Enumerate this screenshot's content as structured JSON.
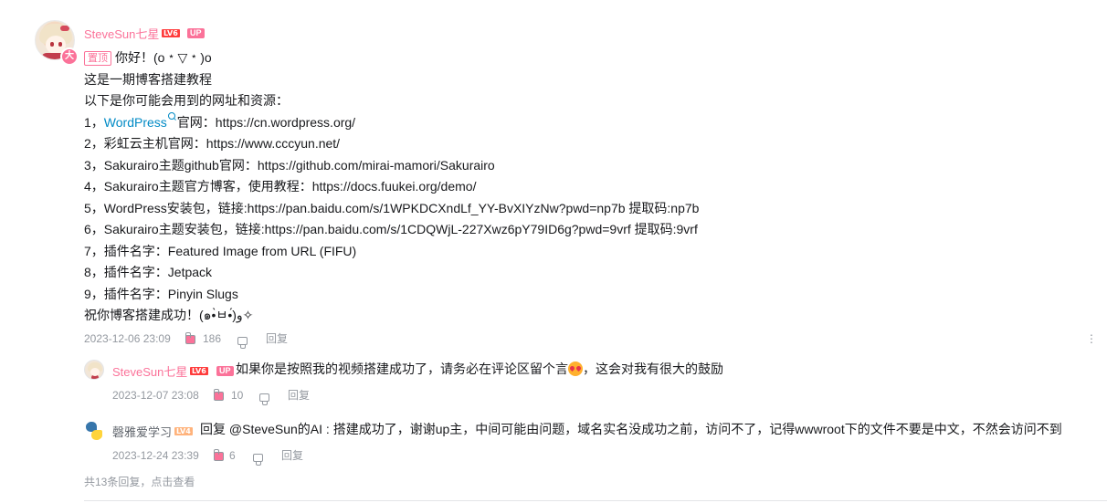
{
  "comment": {
    "username": "SteveSun七星",
    "level_badge": "LV6",
    "up_badge": "UP",
    "vip_badge": "大",
    "pinned_label": "置顶",
    "lines": [
      "你好！(o﹡▽﹡)o",
      "这是一期博客搭建教程",
      "以下是你可能会用到的网址和资源：",
      "1，",
      "2，彩虹云主机官网：https://www.cccyun.net/",
      "3，Sakurairo主题github官网：https://github.com/mirai-mamori/Sakurairo",
      "4，Sakurairo主题官方博客，使用教程：https://docs.fuukei.org/demo/",
      "5，WordPress安装包，链接:https://pan.baidu.com/s/1WPKDCXndLf_YY-BvXIYzNw?pwd=np7b 提取码:np7b",
      "6，Sakurairo主题安装包，链接:https://pan.baidu.com/s/1CDQWjL-227Xwz6pY79ID6g?pwd=9vrf 提取码:9vrf",
      "7，插件名字：Featured Image from URL (FIFU)",
      "8，插件名字：Jetpack",
      "9，插件名字：Pinyin Slugs",
      "祝你博客搭建成功！(๑•̀ㅂ•́)و✧"
    ],
    "wp_link_text": "WordPress",
    "wp_link_rest": "官网：https://cn.wordpress.org/",
    "timestamp": "2023-12-06 23:09",
    "likes": "186",
    "reply_label": "回复",
    "more_icon": "more-vertical-icon"
  },
  "replies": [
    {
      "username": "SteveSun七星",
      "level_badge": "LV6",
      "up_badge": "UP",
      "text_before": "如果你是按照我的视频搭建成功了，请务必在评论区留个言",
      "text_after": "，这会对我有很大的鼓励",
      "timestamp": "2023-12-07 23:08",
      "likes": "10",
      "reply_label": "回复"
    },
    {
      "username": "磬雅爱学习",
      "level_badge": "LV4",
      "text": "回复 @SteveSun的AI : 搭建成功了，谢谢up主，中间可能由问题，域名实名没成功之前，访问不了，记得wwwroot下的文件不要是中文，不然会访问不到",
      "timestamp": "2023-12-24 23:39",
      "likes": "6",
      "reply_label": "回复"
    }
  ],
  "more_replies": "共13条回复，点击查看",
  "colors": {
    "accent_pink": "#fb7299",
    "link_blue": "#008ac5",
    "meta_gray": "#9499a0"
  }
}
